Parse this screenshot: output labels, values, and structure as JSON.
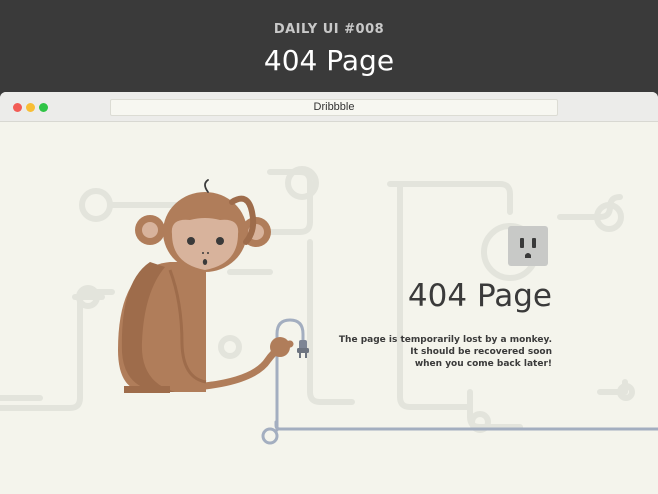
{
  "header": {
    "kicker": "DAILY UI #008",
    "title": "404 Page"
  },
  "browser": {
    "address": "Dribbble",
    "traffic_lights": {
      "close": "#f25c55",
      "minimize": "#f8be35",
      "zoom": "#30c446"
    }
  },
  "content": {
    "title": "404 Page",
    "message": [
      "The page is temporarily lost by a monkey.",
      "It should be recovered soon",
      "when you come back later!"
    ]
  },
  "colors": {
    "background": "#3a3a3a",
    "page": "#f4f4ec",
    "monkey_fur": "#b07d5a",
    "cable": "#a3aec0"
  },
  "icons": [
    "power-outlet-icon",
    "power-plug-icon",
    "monkey-illustration"
  ]
}
